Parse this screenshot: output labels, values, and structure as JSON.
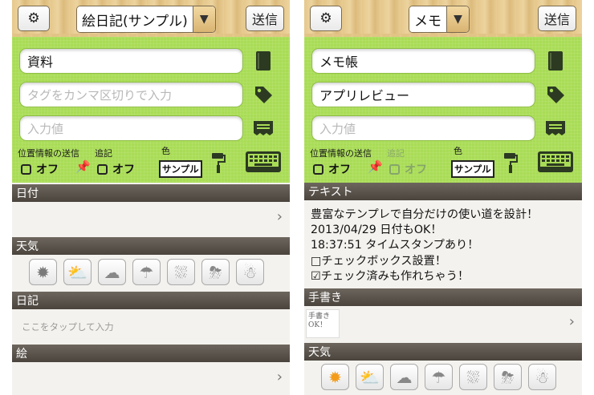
{
  "left": {
    "selector_label": "絵日記(サンプル)",
    "send_label": "送信",
    "fields": {
      "title_value": "資料",
      "tags_placeholder": "タグをカンマ区切りで入力",
      "value_placeholder": "入力値"
    },
    "options": {
      "location_label": "位置情報の送信",
      "location_value": "オフ",
      "append_label": "追記",
      "append_value": "オフ",
      "color_label": "色",
      "color_sample": "サンプル"
    },
    "sections": {
      "date": "日付",
      "weather": "天気",
      "diary": "日記",
      "diary_hint": "ここをタップして入力",
      "picture": "絵"
    }
  },
  "right": {
    "selector_label": "メモ",
    "send_label": "送信",
    "fields": {
      "title_value": "メモ帳",
      "tags_value": "アプリレビュー",
      "value_placeholder": "入力値"
    },
    "options": {
      "location_label": "位置情報の送信",
      "location_value": "オフ",
      "append_label": "追記",
      "append_value": "オフ",
      "color_label": "色",
      "color_sample": "サンプル"
    },
    "sections": {
      "text": "テキスト",
      "text_lines": [
        "豊富なテンプレで自分だけの使い道を設計！",
        "2013/04/29 日付もOK！",
        "18:37:51 タイムスタンプあり！",
        "□チェックボックス設置！",
        "☑チェック済みも作れちゃう！"
      ],
      "handwriting": "手書き",
      "handwriting_thumb": "手書き OK！",
      "weather": "天気"
    }
  },
  "icons": {
    "gear": "gear-icon",
    "book": "book-icon",
    "tag": "tag-icon",
    "note": "note-icon",
    "pin": "pin-icon",
    "paint_roller": "paint-roller-icon",
    "keyboard": "keyboard-icon",
    "chevron": "chevron-right-icon",
    "weather": [
      "sunny-icon",
      "partly-cloudy-icon",
      "cloudy-icon",
      "rain-icon",
      "heavy-rain-icon",
      "thunderstorm-icon",
      "snow-icon"
    ]
  },
  "colors": {
    "form_green": "#a9dc56",
    "section_header": "#5a544c",
    "wood": "#e6c88c"
  }
}
